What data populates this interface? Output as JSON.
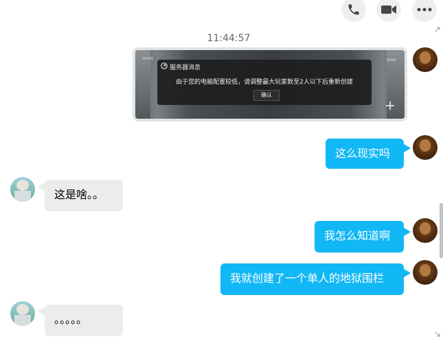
{
  "header": {
    "icons": [
      "phone-icon",
      "video-camera-icon",
      "more-icon"
    ]
  },
  "timestamp": "11:44:57",
  "image_message": {
    "dialog_title": "服务器消息",
    "dialog_text": "由于您的电脑配置较低，请调整最大玩家数至2人以下后重新创建",
    "dialog_button": "确认"
  },
  "messages": {
    "m1": "这么现实吗",
    "m2": "这是啥。。",
    "m3": "我怎么知道啊",
    "m4": "我就创建了一个单人的地狱围栏",
    "m5": "。。。。。"
  },
  "colors": {
    "self_bubble": "#12b7f5",
    "friend_bubble": "#ececec"
  }
}
